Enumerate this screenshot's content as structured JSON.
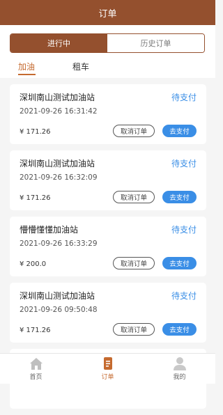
{
  "header": {
    "title": "订单"
  },
  "segment": {
    "active": "进行中",
    "inactive": "历史订单"
  },
  "subtabs": {
    "fuel": "加油",
    "rent": "租车"
  },
  "orders": [
    {
      "station": "深圳南山测试加油站",
      "status": "待支付",
      "time": "2021-09-26 16:31:42",
      "amount": "¥ 171.26",
      "cancel": "取消订单",
      "pay": "去支付"
    },
    {
      "station": "深圳南山测试加油站",
      "status": "待支付",
      "time": "2021-09-26 16:32:09",
      "amount": "¥ 171.26",
      "cancel": "取消订单",
      "pay": "去支付"
    },
    {
      "station": "懵懵懂懂加油站",
      "status": "待支付",
      "time": "2021-09-26 16:33:29",
      "amount": "¥ 200.0",
      "cancel": "取消订单",
      "pay": "去支付"
    },
    {
      "station": "深圳南山测试加油站",
      "status": "待支付",
      "time": "2021-09-26 09:50:48",
      "amount": "¥ 171.26",
      "cancel": "取消订单",
      "pay": "去支付"
    }
  ],
  "tabbar": {
    "home": "首页",
    "orders": "订单",
    "mine": "我的"
  },
  "colors": {
    "brand": "#94502e",
    "accent": "#c56a2f",
    "pay_blue": "#3a8ee6"
  },
  "icons": {
    "home": "home-icon",
    "orders": "document-icon",
    "mine": "user-icon"
  }
}
